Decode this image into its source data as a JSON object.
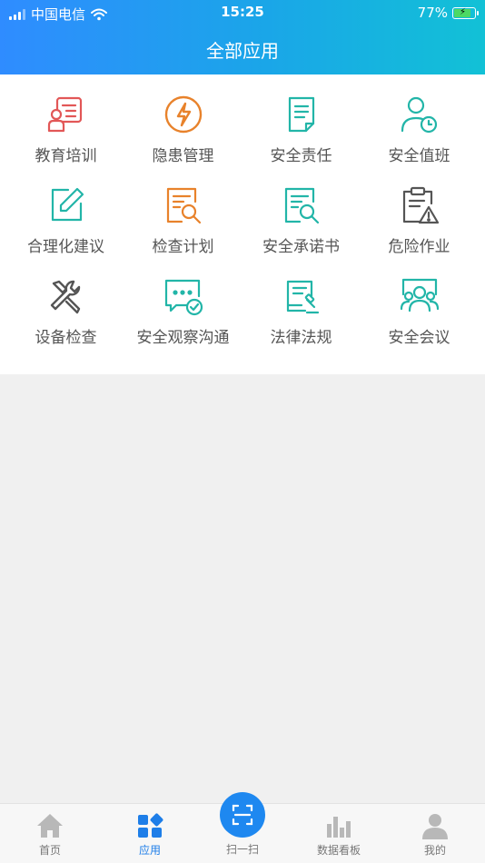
{
  "status_bar": {
    "carrier": "中国电信",
    "time": "15:25",
    "battery": "77%"
  },
  "header": {
    "title": "全部应用"
  },
  "apps": [
    {
      "label": "教育培训",
      "icon": "training-icon",
      "color": "#e25757"
    },
    {
      "label": "隐患管理",
      "icon": "lightning-icon",
      "color": "#e8822b"
    },
    {
      "label": "安全责任",
      "icon": "document-icon",
      "color": "#22b5a8"
    },
    {
      "label": "安全值班",
      "icon": "person-clock-icon",
      "color": "#22b5a8"
    },
    {
      "label": "合理化建议",
      "icon": "edit-icon",
      "color": "#22b5a8"
    },
    {
      "label": "检查计划",
      "icon": "search-document-icon",
      "color": "#e8822b"
    },
    {
      "label": "安全承诺书",
      "icon": "search-document-icon",
      "color": "#22b5a8"
    },
    {
      "label": "危险作业",
      "icon": "clipboard-warning-icon",
      "color": "#555555"
    },
    {
      "label": "设备检查",
      "icon": "tools-icon",
      "color": "#555555"
    },
    {
      "label": "安全观察沟通",
      "icon": "chat-check-icon",
      "color": "#22b5a8"
    },
    {
      "label": "法律法规",
      "icon": "law-book-icon",
      "color": "#22b5a8"
    },
    {
      "label": "安全会议",
      "icon": "meeting-icon",
      "color": "#22b5a8"
    }
  ],
  "tabbar": {
    "home": "首页",
    "apps": "应用",
    "scan": "扫一扫",
    "dashboard": "数据看板",
    "mine": "我的"
  },
  "colors": {
    "header_start": "#2f8cff",
    "header_end": "#12c1d6",
    "accent": "#1e88f0",
    "teal": "#22b5a8",
    "orange": "#e8822b",
    "red": "#e25757"
  }
}
